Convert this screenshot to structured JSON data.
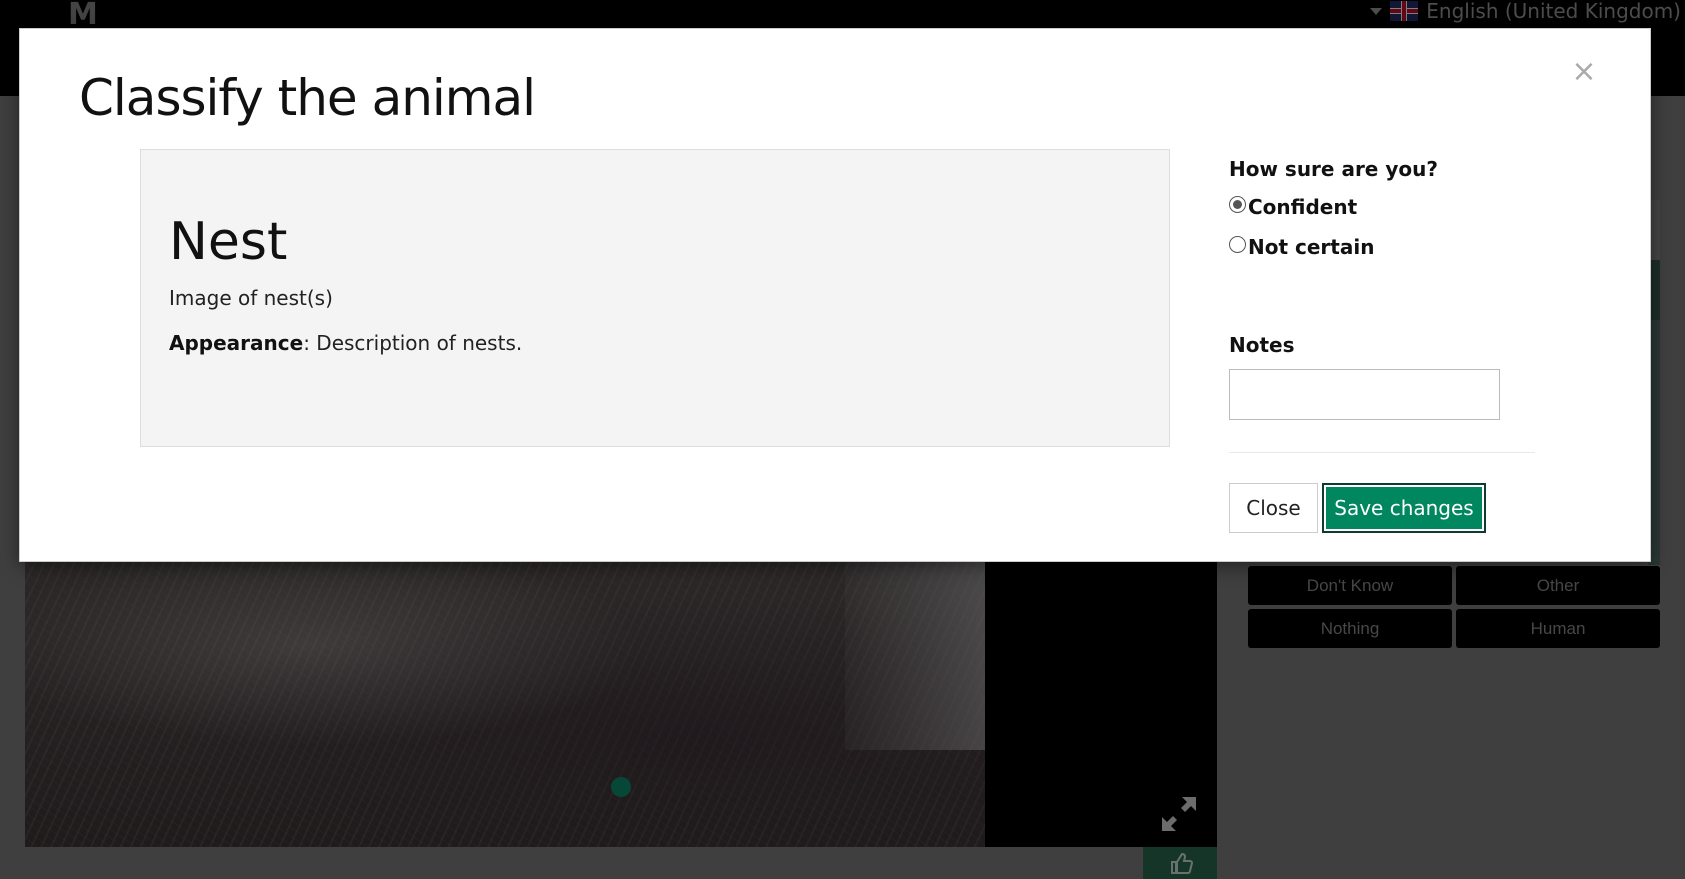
{
  "header": {
    "language_label": "English (United Kingdom)",
    "flag_icon": "uk-flag-icon"
  },
  "background": {
    "choices": [
      "Don't Know",
      "Other",
      "Nothing",
      "Human"
    ],
    "marker_color": "#0f8f70"
  },
  "modal": {
    "title": "Classify the animal",
    "close_glyph": "×",
    "species": {
      "name": "Nest",
      "description": "Image of nest(s)",
      "appearance_label": "Appearance",
      "appearance_text": ": Description of nests."
    },
    "confidence": {
      "question": "How sure are you?",
      "options": [
        {
          "label": "Confident",
          "checked": true
        },
        {
          "label": "Not certain",
          "checked": false
        }
      ]
    },
    "notes": {
      "label": "Notes",
      "value": "",
      "placeholder": ""
    },
    "buttons": {
      "close_label": "Close",
      "save_label": "Save changes"
    },
    "colors": {
      "save_button": "#00875f"
    }
  }
}
